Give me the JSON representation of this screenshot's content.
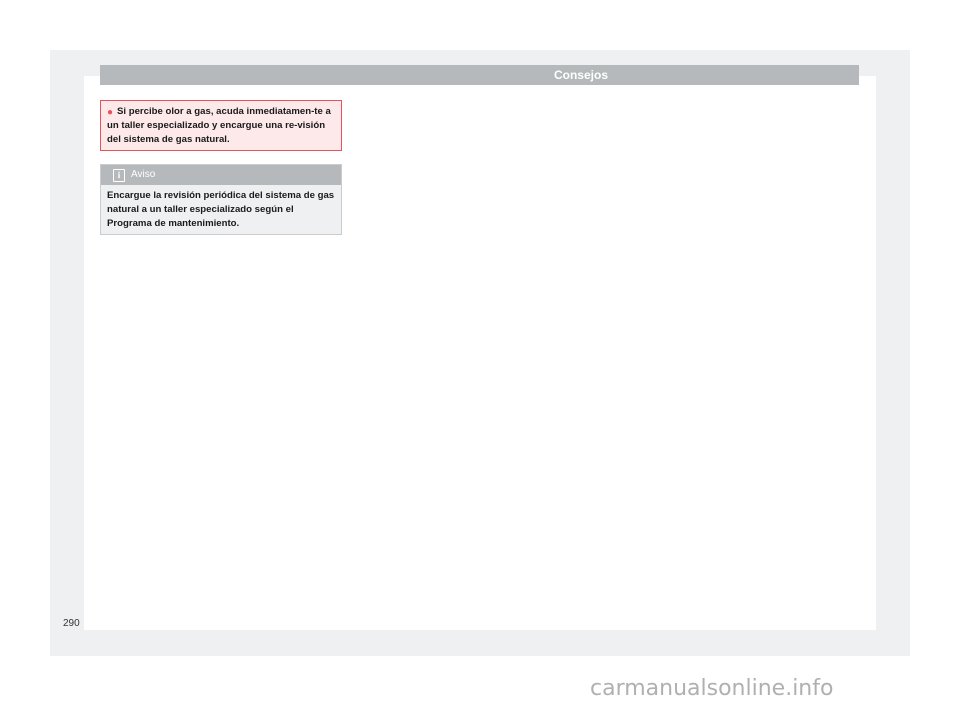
{
  "header": {
    "title": "Consejos"
  },
  "warning": {
    "bullet": "●",
    "text": "Si percibe olor a gas, acuda inmediatamen-te a un taller especializado y encargue una re-visión del sistema de gas natural."
  },
  "note": {
    "icon": "info-icon",
    "title": "Aviso",
    "text": "Encargue la revisión periódica del sistema de gas natural a un taller especializado según el Programa de mantenimiento."
  },
  "page_number": "290",
  "watermark": "carmanualsonline.info",
  "colors": {
    "accent_red": "#e8525a",
    "warning_bg": "#fde9ea",
    "header_gray": "#b5b9bb",
    "frame_gray": "#eef0f1"
  }
}
